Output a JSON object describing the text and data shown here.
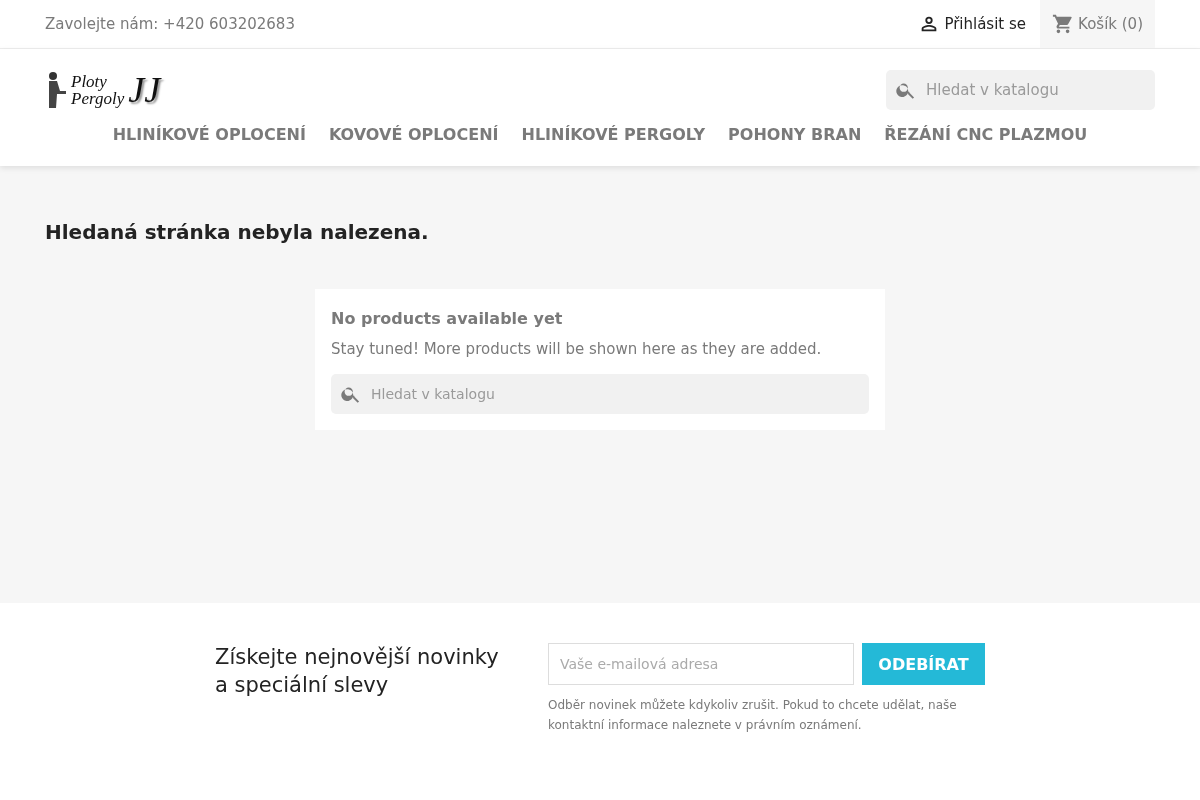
{
  "topbar": {
    "contact": "Zavolejte nám: +420 603202683",
    "login": "Přihlásit se",
    "cart": "Košík (0)"
  },
  "logo": {
    "line_1": "Ploty",
    "line_2": "Pergoly",
    "initials": "JJ"
  },
  "header_search": {
    "placeholder": "Hledat v katalogu"
  },
  "nav": [
    "HLINÍKOVÉ OPLOCENÍ",
    "KOVOVÉ OPLOCENÍ",
    "HLINÍKOVÉ PERGOLY",
    "POHONY BRAN",
    "ŘEZÁNÍ CNC PLAZMOU"
  ],
  "page_title": "Hledaná stránka nebyla nalezena.",
  "empty_card": {
    "title": "No products available yet",
    "text": "Stay tuned! More products will be shown here as they are added.",
    "search_placeholder": "Hledat v katalogu"
  },
  "newsletter": {
    "heading": "Získejte nejnovější novinky a speciální slevy",
    "email_placeholder": "Vaše e-mailová adresa",
    "button": "ODEBÍRAT",
    "note": "Odběr novinek můžete kdykoliv zrušit. Pokud to chcete udělat, naše kontaktní informace naleznete v právním oznámení."
  }
}
